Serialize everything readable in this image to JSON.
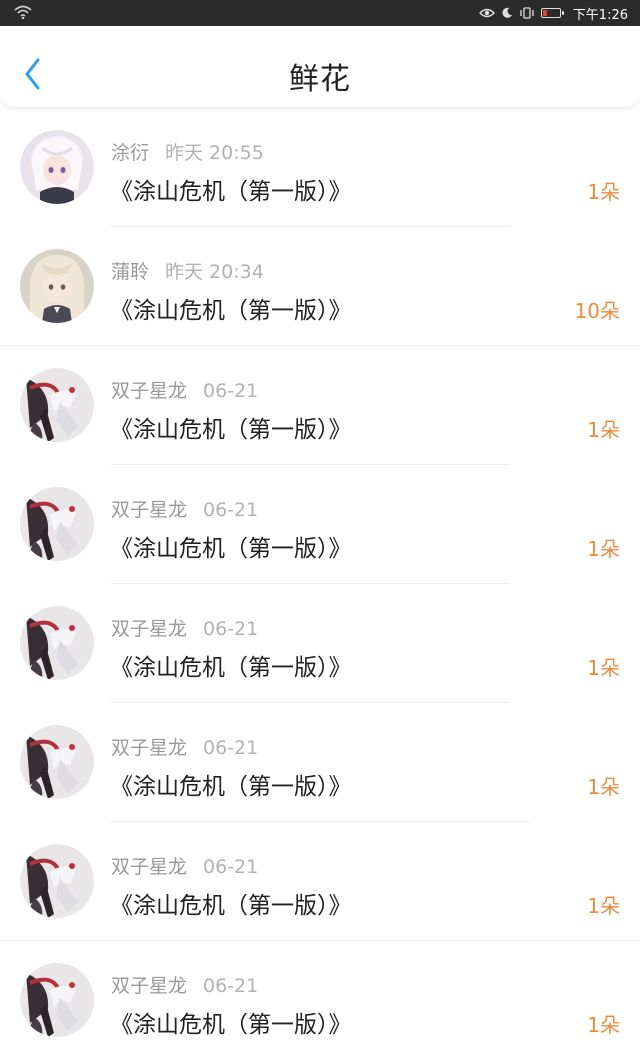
{
  "status_bar": {
    "time": "下午1:26",
    "icons": [
      "wifi-icon",
      "eye-icon",
      "moon-icon",
      "vibrate-icon",
      "battery-icon"
    ],
    "battery_color": "#e04040"
  },
  "header": {
    "title": "鲜花",
    "back_icon": "chevron-left-icon",
    "accent_color": "#2a9cf0"
  },
  "colors": {
    "count": "#ef8a3c",
    "meta": "#9a9a9a",
    "book": "#222222"
  },
  "items": [
    {
      "name": "涂衍",
      "time": "昨天 20:55",
      "book": "《涂山危机（第一版）》",
      "count": "1朵",
      "avatar": "white-hair-girl-avatar"
    },
    {
      "name": "蒲聆",
      "time": "昨天 20:34",
      "book": "《涂山危机（第一版）》",
      "count": "10朵",
      "avatar": "blonde-girl-avatar"
    },
    {
      "name": "双子星龙",
      "time": "06-21",
      "book": "《涂山危机（第一版）》",
      "count": "1朵",
      "avatar": "dragon-rider-avatar"
    },
    {
      "name": "双子星龙",
      "time": "06-21",
      "book": "《涂山危机（第一版）》",
      "count": "1朵",
      "avatar": "dragon-rider-avatar"
    },
    {
      "name": "双子星龙",
      "time": "06-21",
      "book": "《涂山危机（第一版）》",
      "count": "1朵",
      "avatar": "dragon-rider-avatar"
    },
    {
      "name": "双子星龙",
      "time": "06-21",
      "book": "《涂山危机（第一版）》",
      "count": "1朵",
      "avatar": "dragon-rider-avatar"
    },
    {
      "name": "双子星龙",
      "time": "06-21",
      "book": "《涂山危机（第一版）》",
      "count": "1朵",
      "avatar": "dragon-rider-avatar"
    },
    {
      "name": "双子星龙",
      "time": "06-21",
      "book": "《涂山危机（第一版）》",
      "count": "1朵",
      "avatar": "dragon-rider-avatar"
    }
  ]
}
